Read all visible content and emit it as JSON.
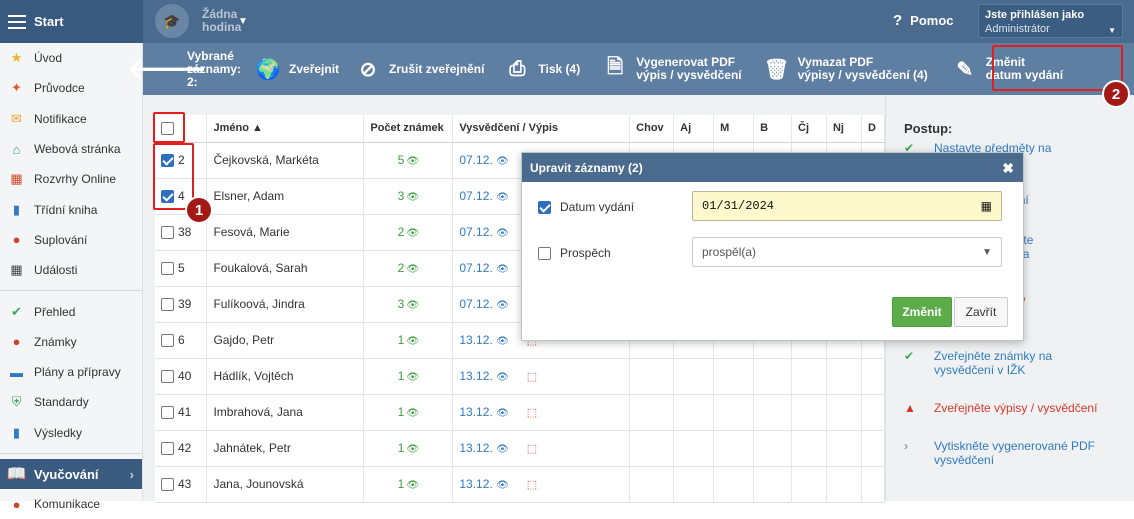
{
  "topbar": {
    "start": "Start",
    "hour_line1": "Žádna",
    "hour_line2": "hodina",
    "help": "Pomoc",
    "user_line1": "Jste přihlášen jako",
    "user_line2": "Administrátor"
  },
  "sidebar": {
    "items": [
      {
        "label": "Úvod",
        "icon": "star-icon",
        "color": "#f0b429"
      },
      {
        "label": "Průvodce",
        "icon": "wand-icon",
        "color": "#e05a2b"
      },
      {
        "label": "Notifikace",
        "icon": "envelope-icon",
        "color": "#f0a030"
      },
      {
        "label": "Webová stránka",
        "icon": "house-icon",
        "color": "#3c9b74"
      },
      {
        "label": "Rozvrhy Online",
        "icon": "grid-icon",
        "color": "#d04a2a"
      },
      {
        "label": "Třídní kniha",
        "icon": "book-icon",
        "color": "#2f7bc3"
      },
      {
        "label": "Suplování",
        "icon": "person-icon",
        "color": "#d0452e"
      },
      {
        "label": "Události",
        "icon": "calendar-icon",
        "color": "#444"
      }
    ],
    "items2": [
      {
        "label": "Přehled",
        "icon": "check-circle-icon",
        "color": "#3cab5a"
      },
      {
        "label": "Známky",
        "icon": "grades-icon",
        "color": "#d0452e"
      },
      {
        "label": "Plány a přípravy",
        "icon": "briefcase-icon",
        "color": "#2f7bc3"
      },
      {
        "label": "Standardy",
        "icon": "shield-icon",
        "color": "#3cab5a"
      },
      {
        "label": "Výsledky",
        "icon": "bar-chart-icon",
        "color": "#2f7bc3"
      }
    ],
    "active": "Vyučování",
    "next": "Komunikace"
  },
  "toolbar": {
    "selected_l1": "Vybrané",
    "selected_l2": "záznamy:",
    "selected_l3": "2:",
    "publish": "Zveřejnit",
    "unpublish": "Zrušit zveřejnění",
    "print": "Tisk (4)",
    "gen_l1": "Vygenerovat PDF",
    "gen_l2": "výpis / vysvědčení",
    "del_l1": "Vymazat PDF",
    "del_l2": "výpisy / vysvědčení (4)",
    "change_l1": "Změnit",
    "change_l2": "datum vydání"
  },
  "badges": {
    "one": "1",
    "two": "2"
  },
  "table": {
    "headers": {
      "name": "Jméno ▲",
      "count": "Počet známek",
      "report": "Vysvědčení / Výpis",
      "chov": "Chov",
      "aj": "Aj",
      "m": "M",
      "b": "B",
      "cj": "Čj",
      "nj": "Nj",
      "d": "D"
    },
    "rows": [
      {
        "num": "2",
        "name": "Čejkovská, Markéta",
        "grades": "5",
        "date": "07.12.",
        "checked": true,
        "pdf": false
      },
      {
        "num": "4",
        "name": "Elsner, Adam",
        "grades": "3",
        "date": "07.12.",
        "checked": true,
        "pdf": false
      },
      {
        "num": "38",
        "name": "Fesová, Marie",
        "grades": "2",
        "date": "07.12.",
        "checked": false,
        "pdf": false
      },
      {
        "num": "5",
        "name": "Foukalová, Sarah",
        "grades": "2",
        "date": "07.12.",
        "checked": false,
        "pdf": false
      },
      {
        "num": "39",
        "name": "Fulíkoová, Jindra",
        "grades": "3",
        "date": "07.12.",
        "checked": false,
        "pdf": false
      },
      {
        "num": "6",
        "name": "Gajdo, Petr",
        "grades": "1",
        "date": "13.12.",
        "checked": false,
        "pdf": true
      },
      {
        "num": "40",
        "name": "Hádlík, Vojtěch",
        "grades": "1",
        "date": "13.12.",
        "checked": false,
        "pdf": true
      },
      {
        "num": "41",
        "name": "Imbrahová, Jana",
        "grades": "1",
        "date": "13.12.",
        "checked": false,
        "pdf": true
      },
      {
        "num": "42",
        "name": "Jahnátek, Petr",
        "grades": "1",
        "date": "13.12.",
        "checked": false,
        "pdf": true
      },
      {
        "num": "43",
        "name": "Jana, Jounovská",
        "grades": "1",
        "date": "13.12.",
        "checked": false,
        "pdf": true
      }
    ]
  },
  "right": {
    "postup": "Postup:",
    "steps": [
      {
        "text": "Nastavte předměty na",
        "state": "done"
      },
      {
        "text": "na vysvědčení",
        "state": "none"
      },
      {
        "text": "vědčení - sečte",
        "text2": "ech, docházka",
        "state": "none"
      },
      {
        "text": "verze výpisů /",
        "state": "red"
      },
      {
        "text": "Zveřejněte známky na",
        "text2": "vysvědčení v IŽK",
        "state": "done"
      },
      {
        "text": "Zveřejněte výpisy / vysvědčení",
        "state": "warn"
      },
      {
        "text": "Vytiskněte vygenerované PDF",
        "text2": "vysvědčení",
        "state": "arrow"
      }
    ]
  },
  "modal": {
    "title": "Upravit záznamy (2)",
    "date_label": "Datum vydání",
    "date_value": "01/31/2024",
    "grade_label": "Prospěch",
    "grade_value": "prospěl(a)",
    "submit": "Změnit",
    "close": "Zavřít"
  }
}
